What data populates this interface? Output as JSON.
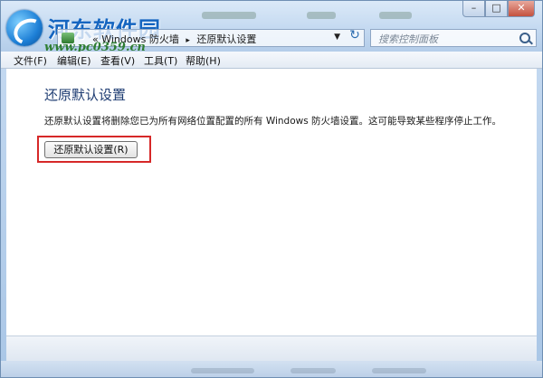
{
  "watermark": {
    "title": "河东软件园",
    "url": "www.pc0359.cn"
  },
  "breadcrumb": {
    "parent": "Windows 防火墙",
    "current": "还原默认设置",
    "prefix": "«"
  },
  "search": {
    "placeholder": "搜索控制面板"
  },
  "menu": {
    "items": [
      {
        "label": "文件(F)"
      },
      {
        "label": "编辑(E)"
      },
      {
        "label": "查看(V)"
      },
      {
        "label": "工具(T)"
      },
      {
        "label": "帮助(H)"
      }
    ]
  },
  "main": {
    "title": "还原默认设置",
    "description": "还原默认设置将删除您已为所有网络位置配置的所有 Windows 防火墙设置。这可能导致某些程序停止工作。",
    "restore_button_label": "还原默认设置(R)"
  },
  "colors": {
    "highlight": "#d62828",
    "title_text": "#1e3c72"
  }
}
